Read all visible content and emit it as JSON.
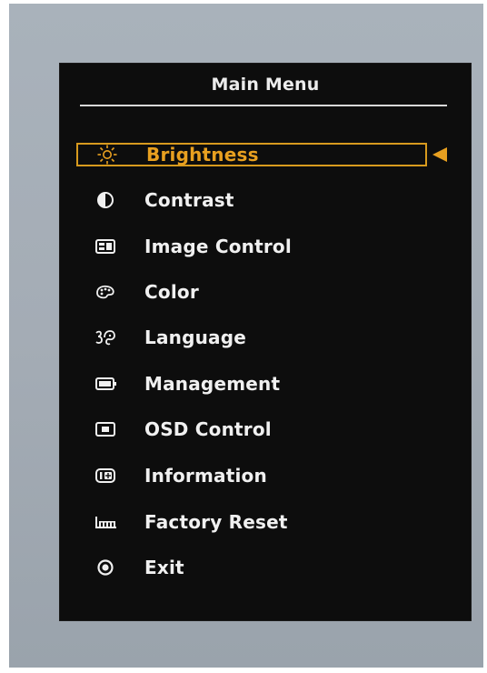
{
  "osd": {
    "title": "Main Menu",
    "items": [
      {
        "label": "Brightness",
        "icon": "brightness-icon",
        "selected": true
      },
      {
        "label": "Contrast",
        "icon": "contrast-icon",
        "selected": false
      },
      {
        "label": "Image Control",
        "icon": "image-control-icon",
        "selected": false
      },
      {
        "label": "Color",
        "icon": "color-palette-icon",
        "selected": false
      },
      {
        "label": "Language",
        "icon": "language-icon",
        "selected": false
      },
      {
        "label": "Management",
        "icon": "management-icon",
        "selected": false
      },
      {
        "label": "OSD Control",
        "icon": "osd-control-icon",
        "selected": false
      },
      {
        "label": "Information",
        "icon": "information-icon",
        "selected": false
      },
      {
        "label": "Factory Reset",
        "icon": "factory-reset-icon",
        "selected": false
      },
      {
        "label": "Exit",
        "icon": "exit-icon",
        "selected": false
      }
    ],
    "colors": {
      "highlight": "#e8a020",
      "text": "#f0f0f0",
      "background": "#0d0d0d"
    }
  }
}
